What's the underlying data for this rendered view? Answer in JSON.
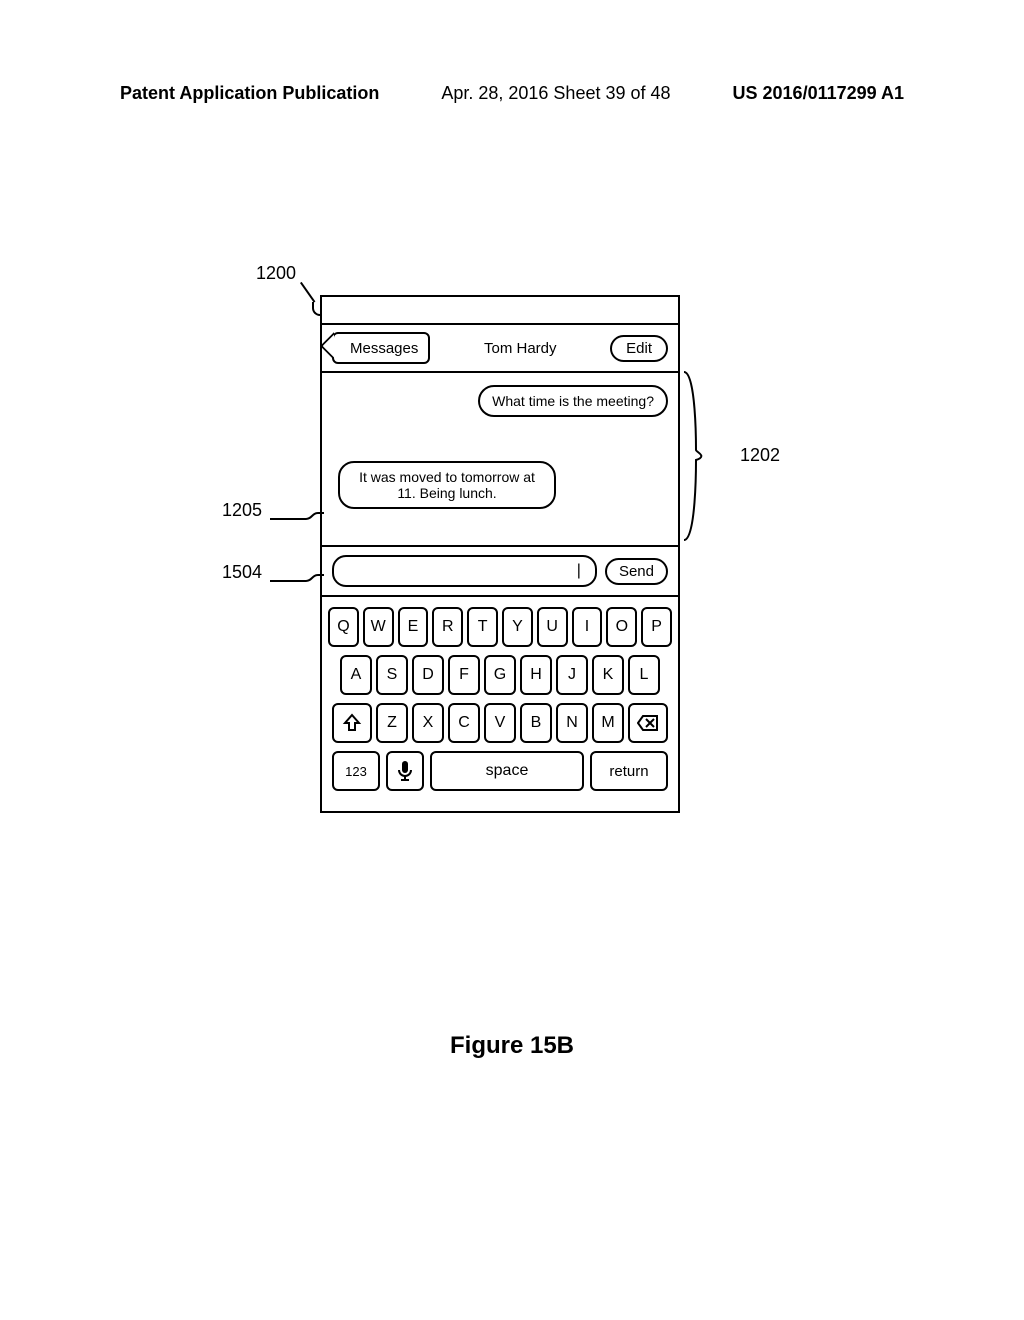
{
  "header": {
    "left": "Patent Application Publication",
    "center": "Apr. 28, 2016  Sheet 39 of 48",
    "right": "US 2016/0117299 A1"
  },
  "callouts": {
    "c1200": "1200",
    "c1202": "1202",
    "c1205": "1205",
    "c1504": "1504"
  },
  "nav": {
    "back": "Messages",
    "title": "Tom Hardy",
    "edit": "Edit"
  },
  "conversation": {
    "outgoing": "What time is the meeting?",
    "incoming": "It was moved to tomorrow at 11. Being lunch."
  },
  "compose": {
    "cursor": "|",
    "send": "Send"
  },
  "keyboard": {
    "row1": [
      "Q",
      "W",
      "E",
      "R",
      "T",
      "Y",
      "U",
      "I",
      "O",
      "P"
    ],
    "row2": [
      "A",
      "S",
      "D",
      "F",
      "G",
      "H",
      "J",
      "K",
      "L"
    ],
    "row3": [
      "Z",
      "X",
      "C",
      "V",
      "B",
      "N",
      "M"
    ],
    "nums": "123",
    "space": "space",
    "ret": "return"
  },
  "figure_caption": "Figure 15B"
}
